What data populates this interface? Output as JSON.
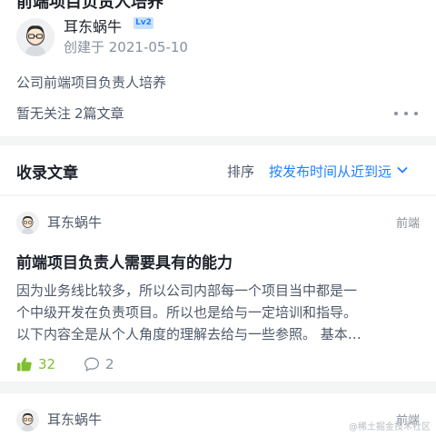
{
  "collection": {
    "title_cut": "前端项目负责人培养",
    "author_name": "耳东蜗牛",
    "level_badge": "Lv2",
    "created": "创建于 2021-05-10",
    "description": "公司前端项目负责人培养",
    "follow_status": "暂无关注",
    "article_count": "2篇文章",
    "more_icon": "more-horizontal-icon"
  },
  "list_header": {
    "title": "收录文章",
    "sort_label": "排序",
    "sort_value": "按发布时间从近到远",
    "sort_icon": "chevron-down-icon"
  },
  "articles": [
    {
      "author": "耳东蜗牛",
      "tag": "前端",
      "title": "前端项目负责人需要具有的能力",
      "abstract_lines": [
        "因为业务线比较多，所以公司内部每一个项目当中都是一",
        "个中级开发在负责项目。所以也是给与一定培训和指导。",
        "以下内容全是从个人角度的理解去给与一些参照。 基本…"
      ],
      "likes": "32",
      "comments": "2"
    },
    {
      "author": "耳东蜗牛",
      "tag": "前端"
    }
  ],
  "watermark": "@稀土掘金技术社区",
  "colors": {
    "accent": "#1e80ff",
    "like_green": "#7fbf2f",
    "muted": "#86909c",
    "background": "#f4f5f5"
  }
}
